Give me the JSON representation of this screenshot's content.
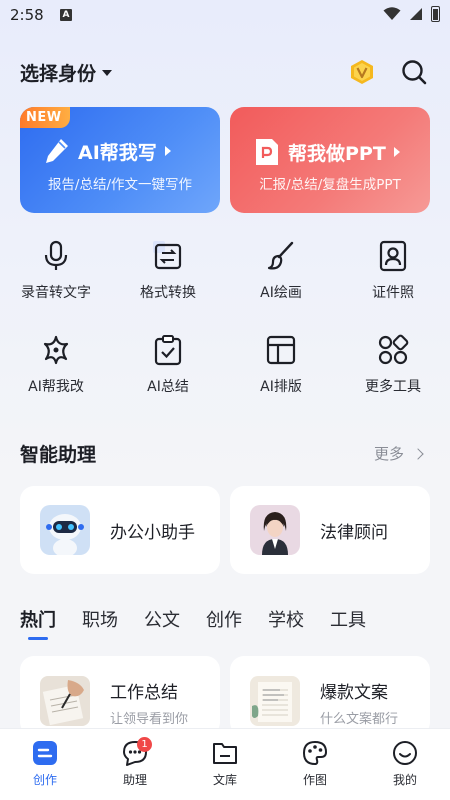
{
  "status_bar": {
    "time": "2:58",
    "indicator": "A"
  },
  "header": {
    "identity": "选择身份",
    "vip_icon": "vip-crown-icon",
    "search_icon": "search-icon"
  },
  "hero": {
    "ai": {
      "tag": "NEW",
      "title": "AI帮我写",
      "subtitle": "报告/总结/作文一键写作",
      "icon": "pencil-icon"
    },
    "ppt": {
      "title": "帮我做PPT",
      "subtitle": "汇报/总结/复盘生成PPT",
      "icon": "ppt-file-icon"
    }
  },
  "tools": [
    {
      "label": "录音转文字",
      "icon": "microphone-icon"
    },
    {
      "label": "格式转换",
      "icon": "convert-icon"
    },
    {
      "label": "AI绘画",
      "icon": "brush-icon"
    },
    {
      "label": "证件照",
      "icon": "portrait-icon"
    },
    {
      "label": "AI帮我改",
      "icon": "sparkle-icon"
    },
    {
      "label": "AI总结",
      "icon": "clipboard-check-icon"
    },
    {
      "label": "AI排版",
      "icon": "layout-icon"
    },
    {
      "label": "更多工具",
      "icon": "grid-icon"
    }
  ],
  "assistant_section": {
    "title": "智能助理",
    "more": "更多",
    "items": [
      {
        "name": "办公小助手",
        "avatar": "robot-avatar"
      },
      {
        "name": "法律顾问",
        "avatar": "lawyer-avatar"
      }
    ]
  },
  "tabs": [
    "热门",
    "职场",
    "公文",
    "创作",
    "学校",
    "工具"
  ],
  "active_tab": "热门",
  "cards": [
    {
      "title": "工作总结",
      "subtitle": "让领导看到你",
      "thumb": "writing-hand-thumb"
    },
    {
      "title": "爆款文案",
      "subtitle": "什么文案都行",
      "thumb": "notebook-thumb"
    }
  ],
  "bottom_nav": [
    {
      "label": "创作",
      "icon": "create-icon",
      "active": true
    },
    {
      "label": "助理",
      "icon": "chat-bubble-icon",
      "badge": "1"
    },
    {
      "label": "文库",
      "icon": "folder-icon"
    },
    {
      "label": "作图",
      "icon": "palette-icon"
    },
    {
      "label": "我的",
      "icon": "smile-icon"
    }
  ],
  "colors": {
    "accent": "#2e6cf0",
    "ppt_red": "#f25b5b",
    "badge_red": "#f04848",
    "new_orange": "#ff7a2a"
  }
}
